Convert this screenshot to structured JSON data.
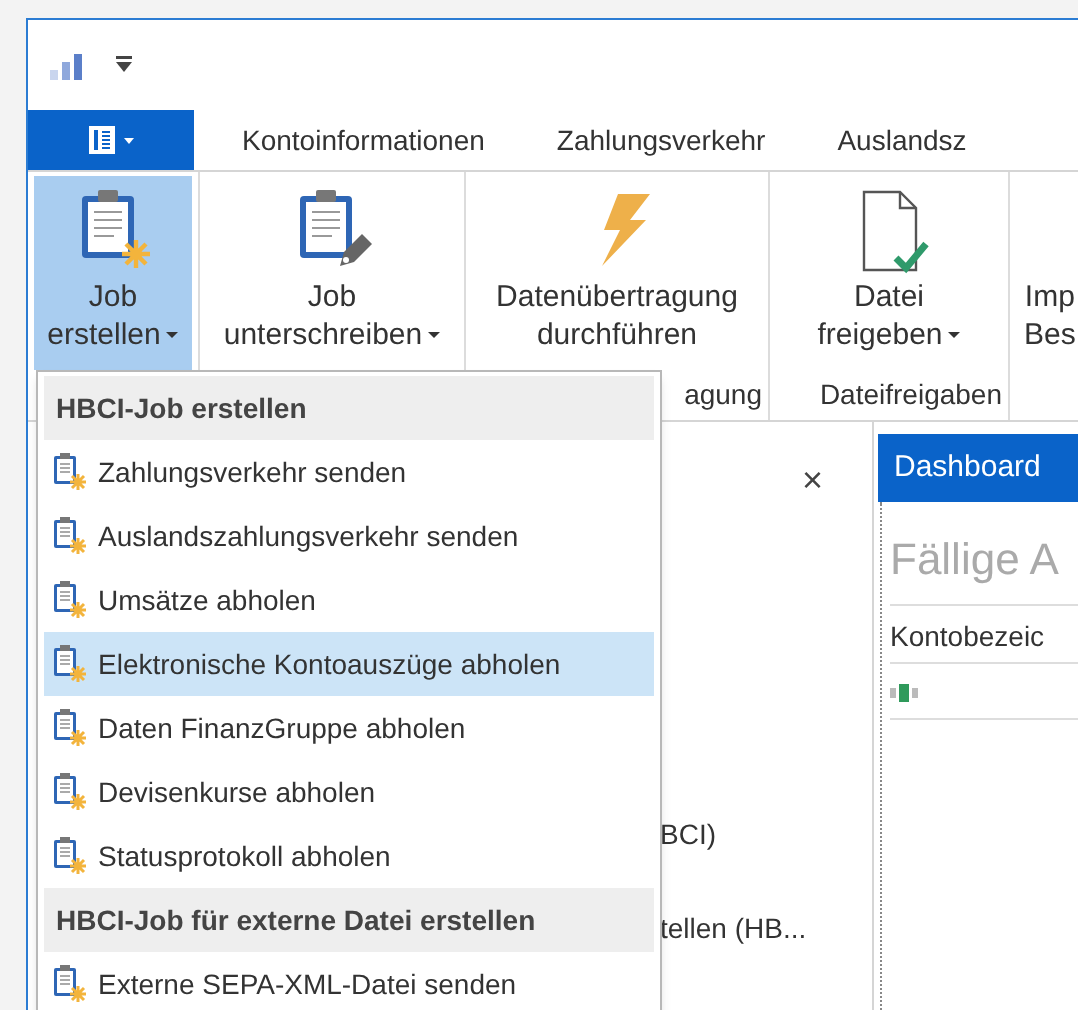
{
  "tabs": [
    {
      "label": "Kontoinformationen",
      "selected": false
    },
    {
      "label": "Zahlungsverkehr",
      "selected": false
    },
    {
      "label": "Auslandsz",
      "selected": false
    }
  ],
  "ribbon": {
    "groups": [
      {
        "buttons": [
          {
            "kind": "clipboard_star",
            "lines": [
              "Job",
              "erstellen"
            ],
            "dropdown": true,
            "pressed": true
          }
        ]
      },
      {
        "buttons": [
          {
            "kind": "clipboard_pen",
            "lines": [
              "Job",
              "unterschreiben"
            ],
            "dropdown": true,
            "pressed": false
          }
        ]
      },
      {
        "label": "agung",
        "buttons": [
          {
            "kind": "bolt",
            "lines": [
              "Datenübertragung",
              "durchführen"
            ],
            "dropdown": false,
            "pressed": false
          }
        ]
      },
      {
        "label": "Dateifreigaben",
        "buttons": [
          {
            "kind": "file_check",
            "lines": [
              "Datei",
              "freigeben"
            ],
            "dropdown": true,
            "pressed": false
          }
        ]
      },
      {
        "buttons": [
          {
            "kind": "none",
            "lines": [
              "Imp",
              "Bes"
            ],
            "dropdown": false,
            "pressed": false
          }
        ]
      }
    ]
  },
  "menu": {
    "sections": [
      {
        "header": "HBCI-Job erstellen",
        "items": [
          {
            "label": "Zahlungsverkehr senden",
            "selected": false
          },
          {
            "label": "Auslandszahlungsverkehr senden",
            "selected": false
          },
          {
            "label": "Umsätze abholen",
            "selected": false
          },
          {
            "label": "Elektronische Kontoauszüge abholen",
            "selected": true
          },
          {
            "label": "Daten FinanzGruppe abholen",
            "selected": false
          },
          {
            "label": "Devisenkurse abholen",
            "selected": false
          },
          {
            "label": "Statusprotokoll abholen",
            "selected": false
          }
        ]
      },
      {
        "header": "HBCI-Job für externe Datei erstellen",
        "items": [
          {
            "label": "Externe SEPA-XML-Datei senden",
            "selected": false
          }
        ]
      }
    ]
  },
  "panel": {
    "close": "×",
    "lines": [
      "BCI)",
      "tellen (HB..."
    ]
  },
  "dashboard": {
    "tab": "Dashboard",
    "heading": "Fällige A",
    "column": "Kontobezeic"
  }
}
